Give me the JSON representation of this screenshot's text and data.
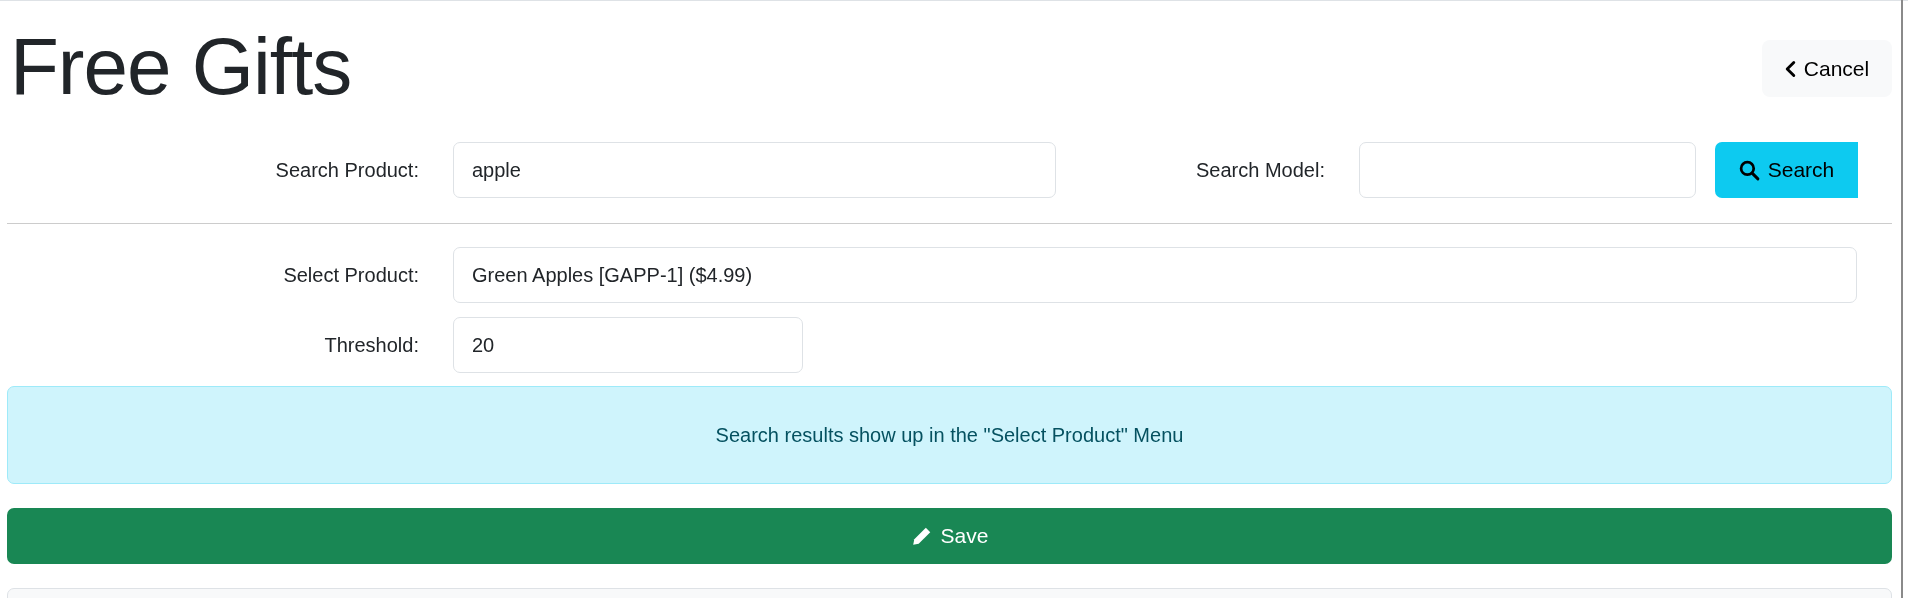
{
  "header": {
    "title": "Free Gifts",
    "cancel_button": "Cancel"
  },
  "search": {
    "product_label": "Search Product:",
    "product_value": "apple",
    "model_label": "Search Model:",
    "search_button": "Search"
  },
  "form": {
    "select_label": "Select Product:",
    "select_value": "Green Apples [GAPP-1] ($4.99)",
    "threshold_label": "Threshold:",
    "threshold_value": "20"
  },
  "alert": {
    "text": "Search results show up in the \"Select Product\" Menu"
  },
  "save_button": "Save"
}
